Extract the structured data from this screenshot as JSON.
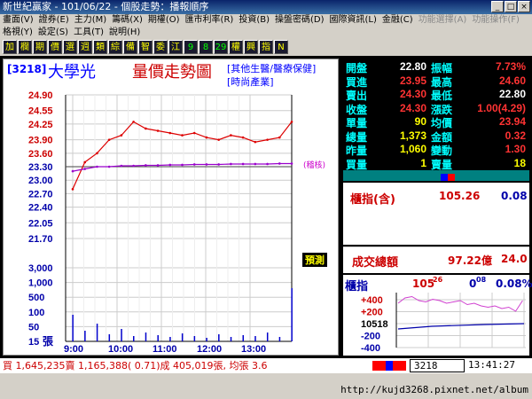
{
  "window": {
    "title": "新世紀贏家 - 101/06/22 - 個股走勢：播報順序"
  },
  "menu": {
    "row1": [
      "畫面(V)",
      "證券(E)",
      "主力(M)",
      "籌碼(X)",
      "期權(O)",
      "匯市利率(R)",
      "投資(B)",
      "操盤密碼(D)",
      "國際資訊(L)",
      "金融(C)",
      "功能選擇(A)",
      "功能操作(F)"
    ],
    "row2": [
      "格視(Y)",
      "設定(S)",
      "工具(T)",
      "說明(H)"
    ]
  },
  "toolbar": {
    "buttons": [
      "加",
      "欄",
      "期",
      "價",
      "選",
      "週",
      "類",
      "綜",
      "備",
      "智",
      "委",
      "江",
      "9",
      "8",
      "29",
      "權",
      "興",
      "指",
      "N"
    ]
  },
  "chart": {
    "stock_code": "[3218]",
    "stock_name": "大學光",
    "chart_title": "量價走勢圖",
    "tag1": "[其他生醫/醫療保健]",
    "tag2": "[時尚產業]",
    "ref_note": "(稽核)",
    "vol_unit": "張",
    "legend_box": "預測",
    "price_ticks": [
      "24.90",
      "24.55",
      "24.25",
      "23.90",
      "23.60",
      "23.30",
      "23.00",
      "22.70",
      "22.40",
      "22.05",
      "21.70"
    ],
    "volume_ticks": [
      "3,000",
      "1,000",
      "500",
      "100",
      "50",
      "15"
    ],
    "time_ticks": [
      "9:00",
      "10:00",
      "11:00",
      "12:00",
      "13:00"
    ]
  },
  "chart_data": {
    "type": "line",
    "title": "量價走勢圖",
    "x": [
      "9:00",
      "9:15",
      "9:30",
      "9:45",
      "10:00",
      "10:15",
      "10:30",
      "10:45",
      "11:00",
      "11:15",
      "11:30",
      "11:45",
      "12:00",
      "12:15",
      "12:30",
      "12:45",
      "13:00",
      "13:15",
      "13:30"
    ],
    "series": [
      {
        "name": "成交價",
        "values": [
          22.8,
          23.4,
          23.6,
          23.9,
          24.0,
          24.3,
          24.15,
          24.1,
          24.05,
          24.0,
          24.05,
          23.95,
          23.9,
          24.0,
          23.95,
          23.85,
          23.9,
          23.95,
          24.3
        ]
      },
      {
        "name": "均價",
        "values": [
          23.2,
          23.25,
          23.3,
          23.3,
          23.32,
          23.32,
          23.33,
          23.33,
          23.34,
          23.34,
          23.35,
          23.35,
          23.35,
          23.36,
          23.36,
          23.36,
          23.36,
          23.37,
          23.37
        ]
      }
    ],
    "ylim": [
      21.7,
      24.9
    ],
    "reference_price": 23.3,
    "grid": true
  },
  "quote": {
    "rows": [
      {
        "k1": "開盤",
        "v1": "22.80",
        "c1": "#ffffff",
        "k2": "振幅",
        "v2": "7.73%",
        "c2": "#ff3333"
      },
      {
        "k1": "買進",
        "v1": "23.95",
        "c1": "#ff3333",
        "k2": "最高",
        "v2": "24.60",
        "c2": "#ff3333"
      },
      {
        "k1": "賣出",
        "v1": "24.30",
        "c1": "#ff3333",
        "k2": "最低",
        "v2": "22.80",
        "c2": "#ffffff"
      },
      {
        "k1": "收盤",
        "v1": "24.30",
        "c1": "#ff3333",
        "k2": "漲跌",
        "v2": "1.00(4.29)",
        "c2": "#ff3333"
      },
      {
        "k1": "單量",
        "v1": "90",
        "c1": "#ffff00",
        "k2": "均價",
        "v2": "23.94",
        "c2": "#ff3333"
      },
      {
        "k1": "總量",
        "v1": "1,373",
        "c1": "#ffff00",
        "k2": "金額",
        "v2": "0.32",
        "c2": "#ff3333"
      },
      {
        "k1": "昨量",
        "v1": "1,060",
        "c1": "#ffff00",
        "k2": "變動",
        "v2": "1.30",
        "c2": "#ff3333"
      },
      {
        "k1": "買量",
        "v1": "1",
        "c1": "#ffff00",
        "k2": "賣量",
        "v2": "18",
        "c2": "#ffff00"
      }
    ],
    "index_label": "櫃指(含)",
    "index_value": "105.26",
    "index_change": "0.08",
    "turnover_label": "成交總額",
    "turnover_value": "97.22億",
    "turnover_change": "24.0",
    "mini_label": "櫃指",
    "mini_value": "105",
    "mini_value_dec": "26",
    "mini_change": "0",
    "mini_change_dec": "08",
    "mini_pct": "0.08%",
    "mini_ticks": [
      "+400",
      "+200",
      "10518",
      "-200",
      "-400"
    ]
  },
  "bottom": {
    "summary": "買 1,645,235賣 1,165,388( 0.71)成 405,019張, 均張 3.6",
    "code_input": "3218",
    "clock": "13:41:27",
    "url": "http://kujd3268.pixnet.net/album"
  }
}
